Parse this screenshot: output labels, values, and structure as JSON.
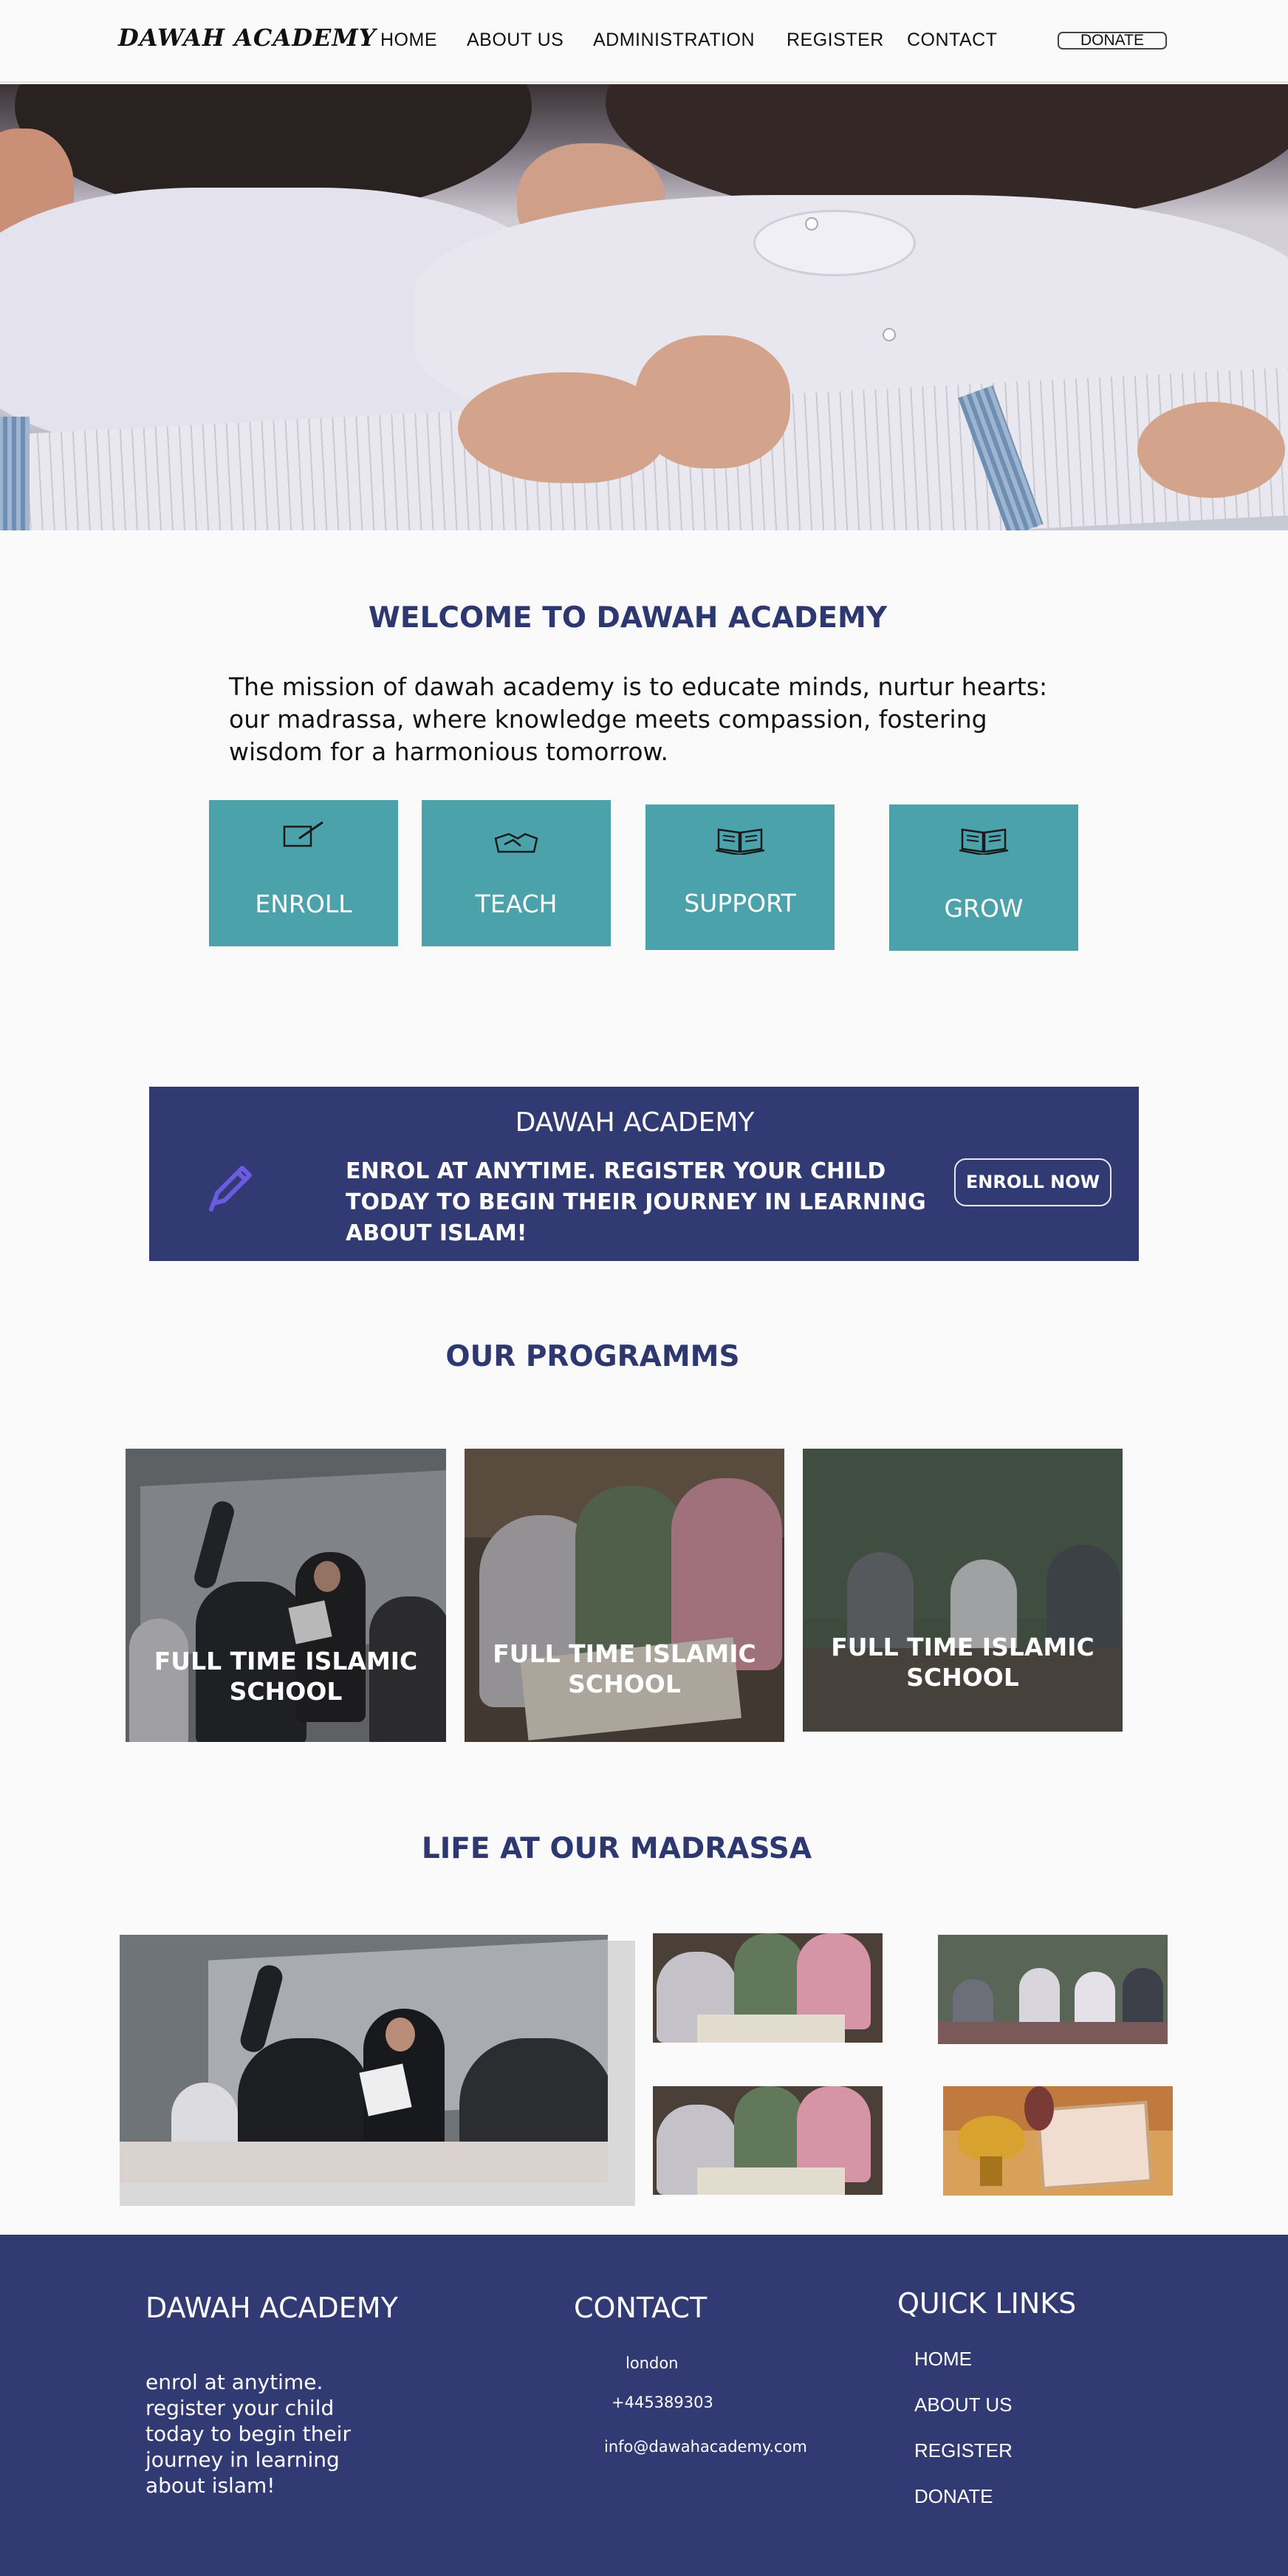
{
  "header": {
    "logo": "DAWAH ACADEMY",
    "nav": {
      "home": "HOME",
      "about": "ABOUT US",
      "administration": "ADMINISTRATION",
      "register": "REGISTER",
      "contact": "CONTACT"
    },
    "donate_label": "DONATE"
  },
  "welcome": {
    "title": "WELCOME TO DAWAH ACADEMY",
    "mission": "The mission of dawah academy is to educate minds, nurtur hearts: our madrassa, where knowledge meets compassion, fostering wisdom for a harmonious tomorrow.",
    "cards": [
      {
        "label": "ENROLL",
        "icon": "pen-paper-icon"
      },
      {
        "label": "TEACH",
        "icon": "handshake-icon"
      },
      {
        "label": "SUPPORT",
        "icon": "open-book-icon"
      },
      {
        "label": "GROW",
        "icon": "open-book-icon"
      }
    ]
  },
  "banner": {
    "title": "DAWAH ACADEMY",
    "text": "ENROL AT ANYTIME. REGISTER YOUR CHILD TODAY TO BEGIN THEIR JOURNEY IN LEARNING ABOUT ISLAM!",
    "button": "ENROLL NOW",
    "icon": "pencil-icon"
  },
  "programs": {
    "title": "OUR PROGRAMMS",
    "items": [
      {
        "title": "FULL TIME ISLAMIC SCHOOL"
      },
      {
        "title": "FULL TIME ISLAMIC SCHOOL"
      },
      {
        "title": "FULL TIME ISLAMIC SCHOOL"
      }
    ]
  },
  "life": {
    "title": "LIFE AT OUR MADRASSA"
  },
  "footer": {
    "about_title": "DAWAH ACADEMY",
    "about_text": "enrol at anytime. register your child today to begin their journey in learning about islam!",
    "contact_title": "CONTACT",
    "location": "london",
    "phone": "+445389303",
    "email": "info@dawahacademy.com",
    "links_title": "QUICK LINKS",
    "links": [
      "HOME",
      "ABOUT US",
      "REGISTER",
      "DONATE"
    ]
  },
  "colors": {
    "navy": "#323a74",
    "heading": "#2d3870",
    "teal": "#4ba2aa",
    "background": "#fafafa"
  }
}
